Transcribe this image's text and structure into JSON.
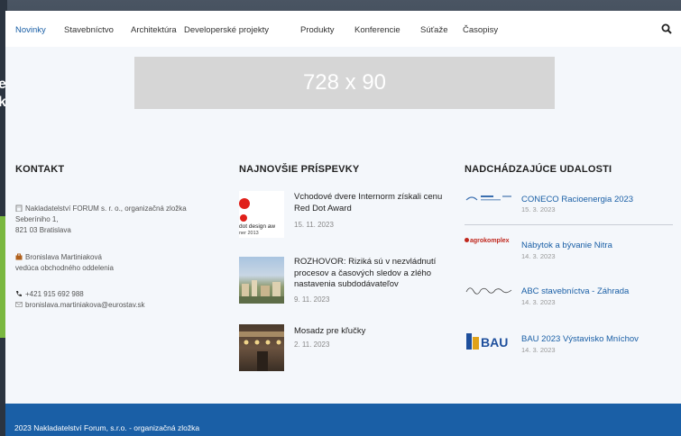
{
  "nav": {
    "items": [
      "Novinky",
      "Stavebníctvo",
      "Architektúra",
      "Developerské projekty",
      "Produkty",
      "Konferencie",
      "Súťaže",
      "Časopisy"
    ],
    "active": "Novinky",
    "search_icon": "search-icon"
  },
  "ad": {
    "text": "728 x 90"
  },
  "contact": {
    "heading": "KONTAKT",
    "company": "Nakladatelství FORUM s. r. o., organizačná zložka",
    "street": "Seberíniho 1,",
    "city": "821 03 Bratislava",
    "person": "Bronislava Martiniaková",
    "role": "vedúca obchodného oddelenia",
    "phone": "+421 915 692 988",
    "email": "bronislava.martiniakova@eurostav.sk"
  },
  "posts": {
    "heading": "NAJNOVŠIE PRÍSPEVKY",
    "items": [
      {
        "title": "Vchodové dvere Internorm získali cenu Red Dot Award",
        "date": "15. 11. 2023",
        "thumb_caption": "dot design aw",
        "thumb_year": "ner 2013"
      },
      {
        "title": "ROZHOVOR: Riziká sú v nezvládnutí procesov a časových sledov a zlého nastavenia subdodávateľov",
        "date": "9. 11. 2023"
      },
      {
        "title": "Mosadz pre kľučky",
        "date": "2. 11. 2023"
      }
    ]
  },
  "events": {
    "heading": "NADCHÁDZAJÚCE UDALOSTI",
    "items": [
      {
        "title": "CONECO Racioenergia 2023",
        "date": "15. 3. 2023",
        "logo": "coneco-logo"
      },
      {
        "title": "Nábytok a bývanie Nitra",
        "date": "14. 3. 2023",
        "logo": "agrokomplex-logo",
        "logo_text": "agrokomplex"
      },
      {
        "title": "ABC stavebníctva - Záhrada",
        "date": "14. 3. 2023",
        "logo": "script-logo"
      },
      {
        "title": "BAU 2023 Výstavisko Mníchov",
        "date": "14. 3. 2023",
        "logo": "bau-logo",
        "logo_text": "BAU"
      }
    ]
  },
  "footer": {
    "text": "2023 Nakladatelství Forum, s.r.o. - organizačná zložka"
  },
  "colors": {
    "accent": "#1a5fa6",
    "footer_bg": "#1a5fa6",
    "page_bg": "#f4f7fb"
  }
}
